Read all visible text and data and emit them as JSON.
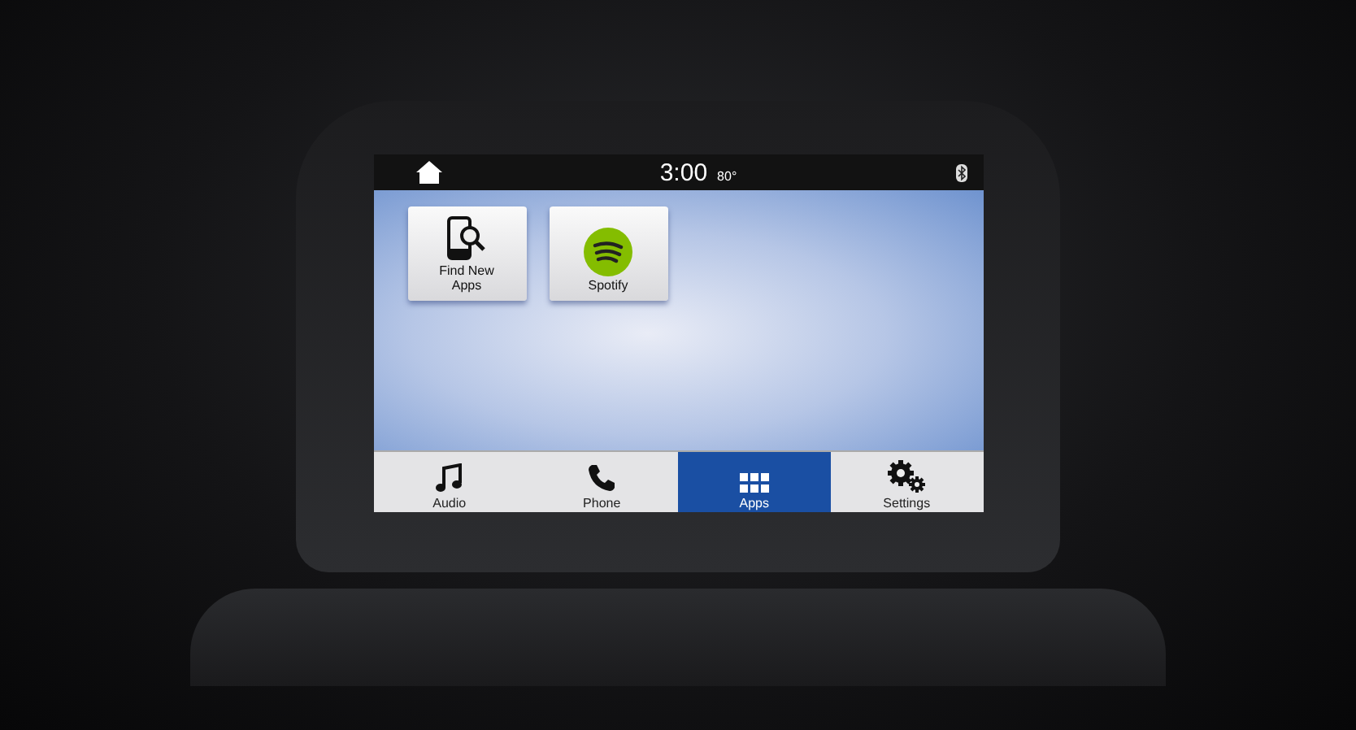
{
  "status_bar": {
    "time": "3:00",
    "temperature": "80°"
  },
  "apps": [
    {
      "label": "Find New Apps",
      "kind": "find"
    },
    {
      "label": "Spotify",
      "kind": "spotify"
    }
  ],
  "nav": [
    {
      "label": "Audio",
      "kind": "audio",
      "selected": false
    },
    {
      "label": "Phone",
      "kind": "phone",
      "selected": false
    },
    {
      "label": "Apps",
      "kind": "apps",
      "selected": true
    },
    {
      "label": "Settings",
      "kind": "settings",
      "selected": false
    }
  ]
}
